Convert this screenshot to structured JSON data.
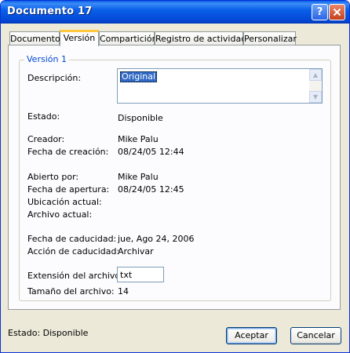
{
  "window": {
    "title": "Documento 17"
  },
  "tabs": [
    {
      "label": "Documento"
    },
    {
      "label": "Versión"
    },
    {
      "label": "Compartición"
    },
    {
      "label": "Registro de actividad"
    },
    {
      "label": "Personalizar"
    }
  ],
  "active_tab": "Versión",
  "version_group": {
    "title": "Versión 1",
    "description_label": "Descripción:",
    "description_value": "Original",
    "state_label": "Estado:",
    "state_value": "Disponible",
    "creator_label": "Creador:",
    "creator_value": "Mike Palu",
    "created_label": "Fecha de creación:",
    "created_value": "08/24/05 12:44",
    "opened_by_label": "Abierto por:",
    "opened_by_value": "Mike Palu",
    "opened_date_label": "Fecha de apertura:",
    "opened_date_value": "08/24/05 12:45",
    "current_location_label": "Ubicación actual:",
    "current_file_label": "Archivo actual:",
    "expiry_date_label": "Fecha de caducidad:",
    "expiry_date_value": "jue, Ago 24, 2006",
    "expiry_action_label": "Acción de caducidad:",
    "expiry_action_value": "Archivar",
    "extension_label": "Extensión del archivo:",
    "extension_value": "txt",
    "size_label": "Tamaño del archivo:",
    "size_value": "14"
  },
  "footer": {
    "status": "Estado: Disponible",
    "ok_label": "Aceptar",
    "cancel_label": "Cancelar"
  },
  "icons": {
    "help": "help-icon",
    "close": "close-icon",
    "scroll_up": "scroll-up-arrow-icon",
    "scroll_down": "scroll-down-arrow-icon"
  },
  "colors": {
    "titlebar": "#0a5fe8",
    "group_title": "#0046d5",
    "selection": "#316ac5",
    "active_tab_accent": "#ffc83c"
  }
}
